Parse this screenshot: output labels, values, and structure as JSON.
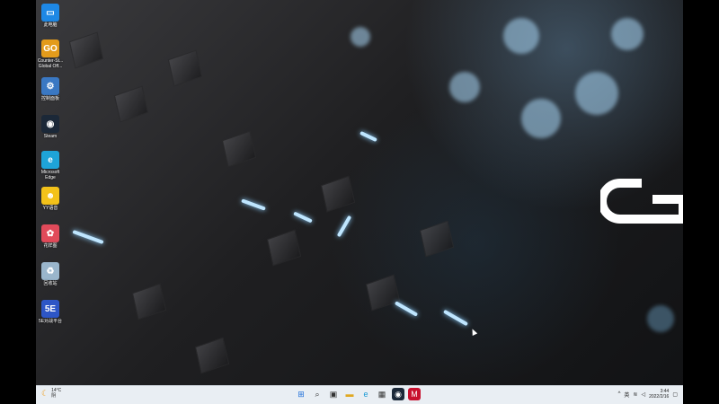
{
  "desktop_icons": [
    {
      "label": "此电脑",
      "icon": "computer-icon",
      "color": "#1e88e5",
      "glyph": "▭"
    },
    {
      "label": "Counter-St...\nGlobal Off...",
      "icon": "csgo-icon",
      "color": "#e39b1b",
      "glyph": "GO"
    },
    {
      "label": "控制面板",
      "icon": "control-panel-icon",
      "color": "#3a78c3",
      "glyph": "⚙"
    },
    {
      "label": "Steam",
      "icon": "steam-icon",
      "color": "#1b2838",
      "glyph": "◉"
    },
    {
      "label": "Microsoft\nEdge",
      "icon": "edge-icon",
      "color": "#1ea4d8",
      "glyph": "e"
    },
    {
      "label": "YY语音",
      "icon": "yy-icon",
      "color": "#f3c21a",
      "glyph": "☻"
    },
    {
      "label": "花样图",
      "icon": "app-icon",
      "color": "#e14a5a",
      "glyph": "✿"
    },
    {
      "label": "回收站",
      "icon": "recycle-bin-icon",
      "color": "#9ab6cc",
      "glyph": "♻"
    },
    {
      "label": "5E对战平台",
      "icon": "5e-platform-icon",
      "color": "#2d56c6",
      "glyph": "5E"
    }
  ],
  "taskbar": {
    "weather": {
      "temp": "14°C",
      "desc": "阴",
      "icon": "weather-moon-icon"
    },
    "apps": [
      {
        "name": "start-icon",
        "glyph": "⊞"
      },
      {
        "name": "search-icon",
        "glyph": "⌕"
      },
      {
        "name": "task-view-icon",
        "glyph": "▣"
      },
      {
        "name": "file-explorer-icon",
        "glyph": "▬"
      },
      {
        "name": "edge-icon",
        "glyph": "e"
      },
      {
        "name": "store-icon",
        "glyph": "▦"
      },
      {
        "name": "steam-icon",
        "glyph": "◉"
      },
      {
        "name": "mcafee-icon",
        "glyph": "M"
      }
    ],
    "tray": {
      "chevron": "^",
      "lang": "英",
      "time": "3:44",
      "date": "2022/2/16"
    }
  }
}
